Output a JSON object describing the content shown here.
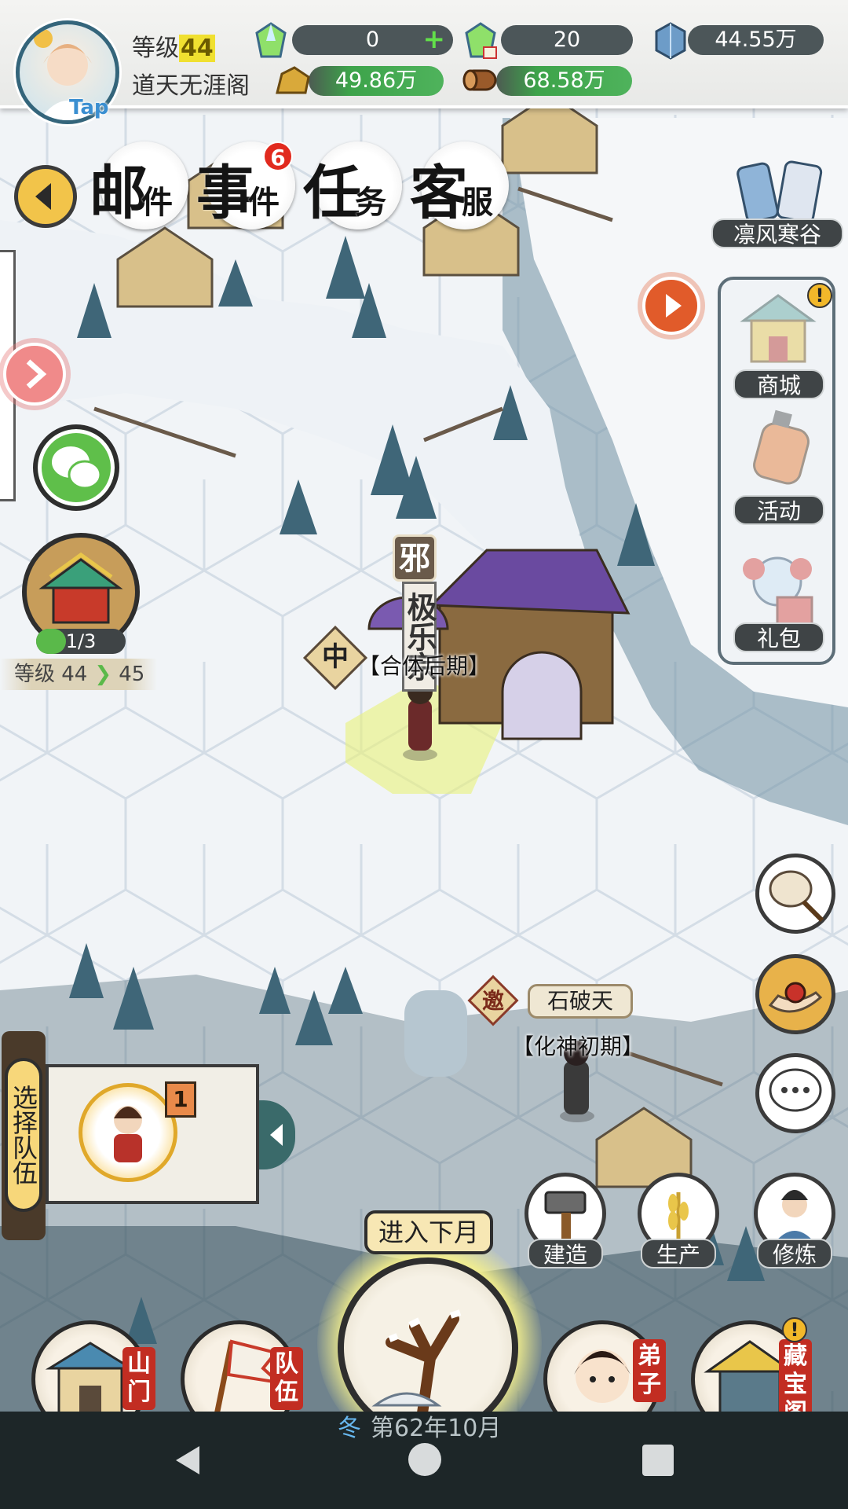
{
  "player": {
    "level_label": "等级",
    "level_value": "44",
    "sect_name": "道天无涯阁",
    "avatar_badge": "Tap"
  },
  "resources": [
    {
      "icon": "spirit-crystal-icon",
      "value": "0",
      "has_plus": true
    },
    {
      "icon": "spirit-crystal-ticket-icon",
      "value": "20"
    },
    {
      "icon": "blue-crystal-icon",
      "value": "44.55万"
    },
    {
      "icon": "gold-ore-icon",
      "value": "49.86万"
    },
    {
      "icon": "wood-log-icon",
      "value": "68.58万"
    }
  ],
  "top_nav": [
    {
      "char": "邮",
      "sub": "件"
    },
    {
      "char": "事",
      "sub": "件",
      "badge": "6"
    },
    {
      "char": "任",
      "sub": "务"
    },
    {
      "char": "客",
      "sub": "服"
    }
  ],
  "region_name": "凛风寒谷",
  "right_menu": [
    "商城",
    "活动",
    "礼包"
  ],
  "building": {
    "progress": "1/3",
    "level_from": "等级 44",
    "level_to": "45"
  },
  "map": {
    "sect_banner_top": "邪",
    "sect_banner_name": "极乐宗",
    "sect_grade": "中",
    "sect_realm": "【合体后期】",
    "npc_tag": "邀",
    "npc_name": "石破天",
    "npc_realm": "【化神初期】"
  },
  "team": {
    "select_label": "选择队伍",
    "member_rank": "1"
  },
  "actions": [
    "建造",
    "生产",
    "修炼"
  ],
  "next_month": "进入下月",
  "bottom_nav": [
    {
      "label": "山门"
    },
    {
      "label": "队伍"
    },
    {
      "label": "弟子"
    },
    {
      "label": "藏宝阁"
    }
  ],
  "season": "冬",
  "date": "第62年10月",
  "colors": {
    "accent_green": "#5ab94a",
    "badge_red": "#e12a1e",
    "tag_red": "#c22d22"
  }
}
